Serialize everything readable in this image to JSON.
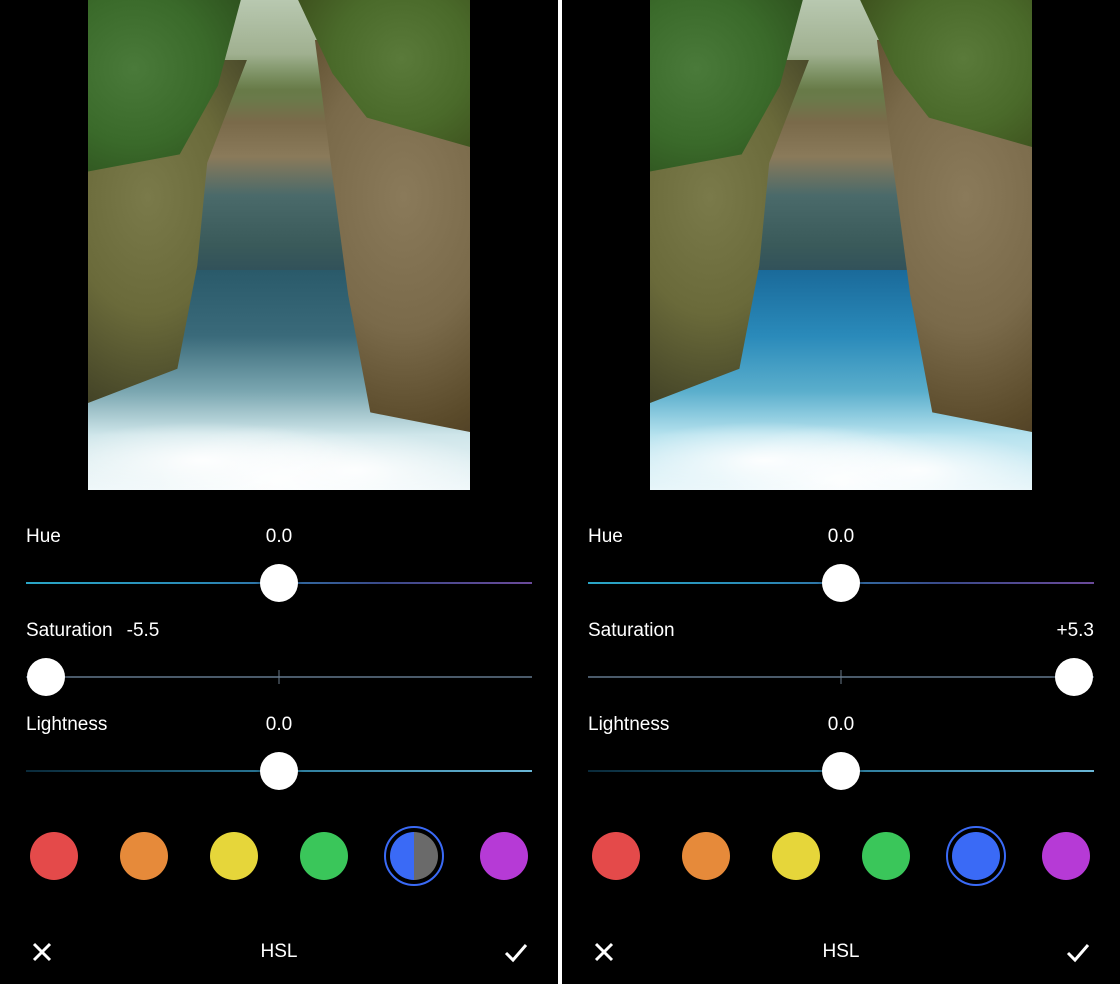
{
  "panels": [
    {
      "sliders": {
        "hue": {
          "label": "Hue",
          "value": "0.0",
          "thumb_pct": 50,
          "value_pos": "center",
          "track": "hue"
        },
        "saturation": {
          "label": "Saturation",
          "value": "-5.5",
          "thumb_pct": 4,
          "value_pos": "near",
          "track": "plain"
        },
        "lightness": {
          "label": "Lightness",
          "value": "0.0",
          "thumb_pct": 50,
          "value_pos": "center",
          "track": "lightness"
        }
      },
      "swatches": [
        {
          "name": "red",
          "color": "#e44a4a",
          "selected": false
        },
        {
          "name": "orange",
          "color": "#e68a3a",
          "selected": false
        },
        {
          "name": "yellow",
          "color": "#e6d63a",
          "selected": false
        },
        {
          "name": "green",
          "color": "#3ac65a",
          "selected": false
        },
        {
          "name": "blue",
          "color": "#3a6af6",
          "selected": true,
          "half_gray": true
        },
        {
          "name": "purple",
          "color": "#b63ad6",
          "selected": false
        }
      ],
      "footer_title": "HSL",
      "photo_variant": "sat-minus"
    },
    {
      "sliders": {
        "hue": {
          "label": "Hue",
          "value": "0.0",
          "thumb_pct": 50,
          "value_pos": "center",
          "track": "hue"
        },
        "saturation": {
          "label": "Saturation",
          "value": "+5.3",
          "thumb_pct": 96,
          "value_pos": "right",
          "track": "plain"
        },
        "lightness": {
          "label": "Lightness",
          "value": "0.0",
          "thumb_pct": 50,
          "value_pos": "center",
          "track": "lightness"
        }
      },
      "swatches": [
        {
          "name": "red",
          "color": "#e44a4a",
          "selected": false
        },
        {
          "name": "orange",
          "color": "#e68a3a",
          "selected": false
        },
        {
          "name": "yellow",
          "color": "#e6d63a",
          "selected": false
        },
        {
          "name": "green",
          "color": "#3ac65a",
          "selected": false
        },
        {
          "name": "blue",
          "color": "#3a6af6",
          "selected": true,
          "half_gray": false
        },
        {
          "name": "purple",
          "color": "#b63ad6",
          "selected": false
        }
      ],
      "footer_title": "HSL",
      "photo_variant": "sat-plus"
    }
  ],
  "icons": {
    "close": "close-icon",
    "check": "check-icon"
  }
}
